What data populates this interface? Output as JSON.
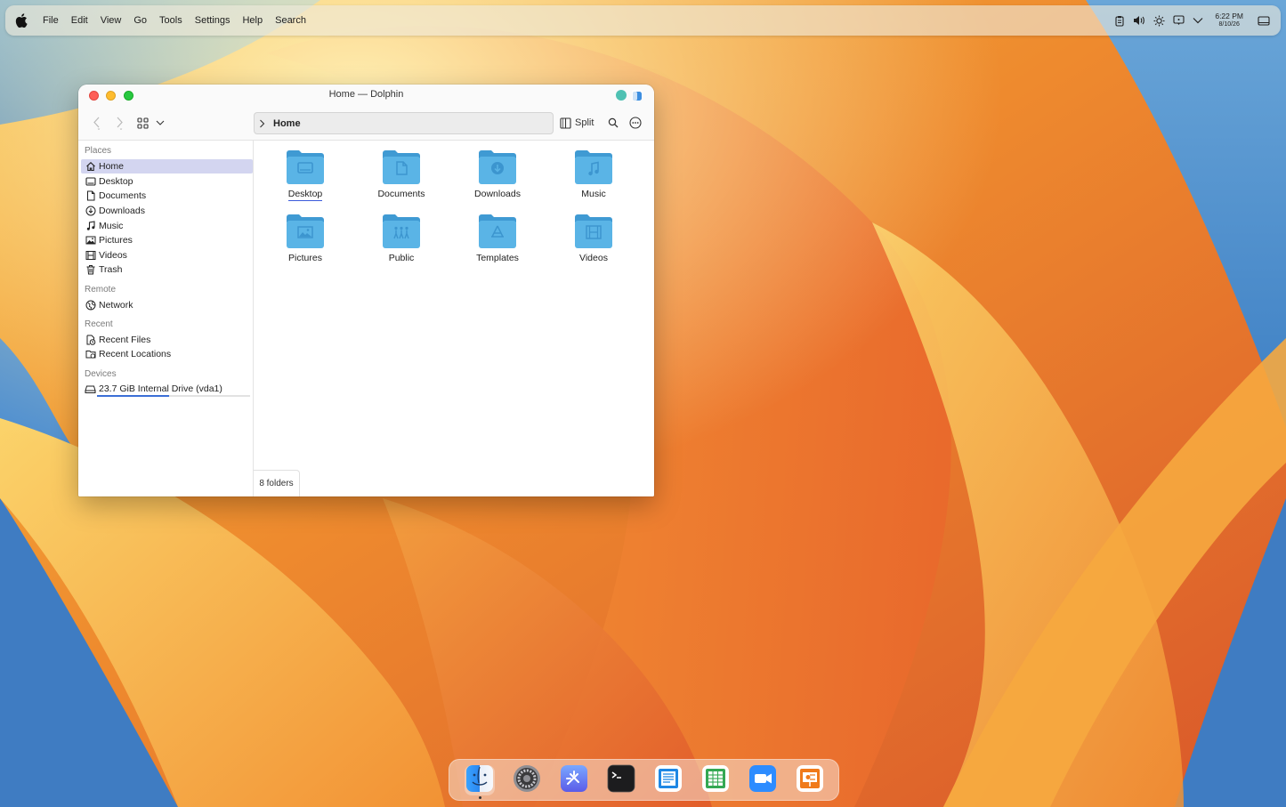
{
  "menubar": {
    "items": [
      "File",
      "Edit",
      "View",
      "Go",
      "Tools",
      "Settings",
      "Help",
      "Search"
    ],
    "clock": {
      "time": "6:22 PM",
      "date": "8/10/26"
    }
  },
  "window": {
    "title": "Home — Dolphin",
    "breadcrumb": "Home",
    "split_label": "Split"
  },
  "sidebar": {
    "sections": {
      "places": "Places",
      "remote": "Remote",
      "recent": "Recent",
      "devices": "Devices"
    },
    "places": [
      {
        "label": "Home",
        "icon": "home-icon"
      },
      {
        "label": "Desktop",
        "icon": "desktop-icon"
      },
      {
        "label": "Documents",
        "icon": "document-icon"
      },
      {
        "label": "Downloads",
        "icon": "download-icon"
      },
      {
        "label": "Music",
        "icon": "music-icon"
      },
      {
        "label": "Pictures",
        "icon": "picture-icon"
      },
      {
        "label": "Videos",
        "icon": "video-icon"
      },
      {
        "label": "Trash",
        "icon": "trash-icon"
      }
    ],
    "remote": [
      {
        "label": "Network",
        "icon": "network-icon"
      }
    ],
    "recent": [
      {
        "label": "Recent Files",
        "icon": "recent-files-icon"
      },
      {
        "label": "Recent Locations",
        "icon": "recent-locations-icon"
      }
    ],
    "devices": [
      {
        "label": "23.7 GiB Internal Drive (vda1)",
        "icon": "drive-icon",
        "used_fraction": 0.47
      }
    ]
  },
  "content": {
    "folders": [
      {
        "label": "Desktop",
        "emblem": "desktop"
      },
      {
        "label": "Documents",
        "emblem": "document"
      },
      {
        "label": "Downloads",
        "emblem": "download"
      },
      {
        "label": "Music",
        "emblem": "music"
      },
      {
        "label": "Pictures",
        "emblem": "picture"
      },
      {
        "label": "Public",
        "emblem": "people"
      },
      {
        "label": "Templates",
        "emblem": "template"
      },
      {
        "label": "Videos",
        "emblem": "video"
      }
    ],
    "status": "8 folders"
  },
  "dock": {
    "apps": [
      "Finder",
      "System Settings",
      "Xcode-like Tool",
      "Terminal",
      "Pages",
      "Numbers",
      "Zoom",
      "Keynote"
    ]
  },
  "colors": {
    "folder_blue": "#5ab4e6",
    "selection": "#d3d5f0",
    "accent": "#3b5bdb"
  }
}
